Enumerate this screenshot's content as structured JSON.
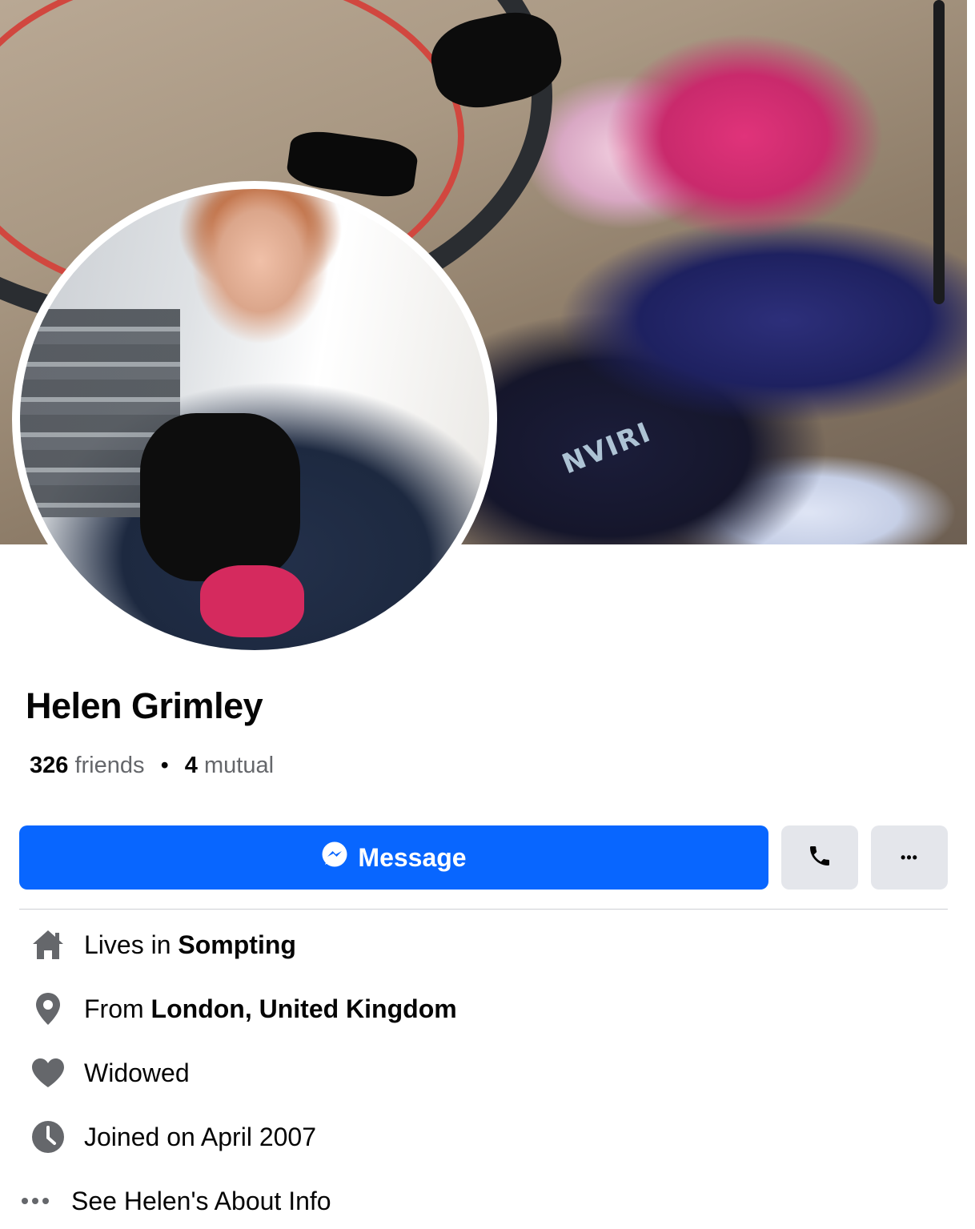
{
  "profile": {
    "name": "Helen Grimley",
    "friends_count": "326",
    "friends_label": "friends",
    "mutual_count": "4",
    "mutual_label": "mutual",
    "separator": "•"
  },
  "actions": {
    "message_label": "Message",
    "more_label": "•••"
  },
  "about": {
    "lives_prefix": "Lives in ",
    "lives_value": "Sompting",
    "from_prefix": "From ",
    "from_value": "London, United Kingdom",
    "relationship": "Widowed",
    "joined": "Joined on April 2007",
    "see_about": "See Helen's About Info"
  },
  "cover_text": "NVIRI",
  "colors": {
    "primary": "#0866ff",
    "secondary_button": "#e4e6eb",
    "icon_gray": "#65676b"
  }
}
